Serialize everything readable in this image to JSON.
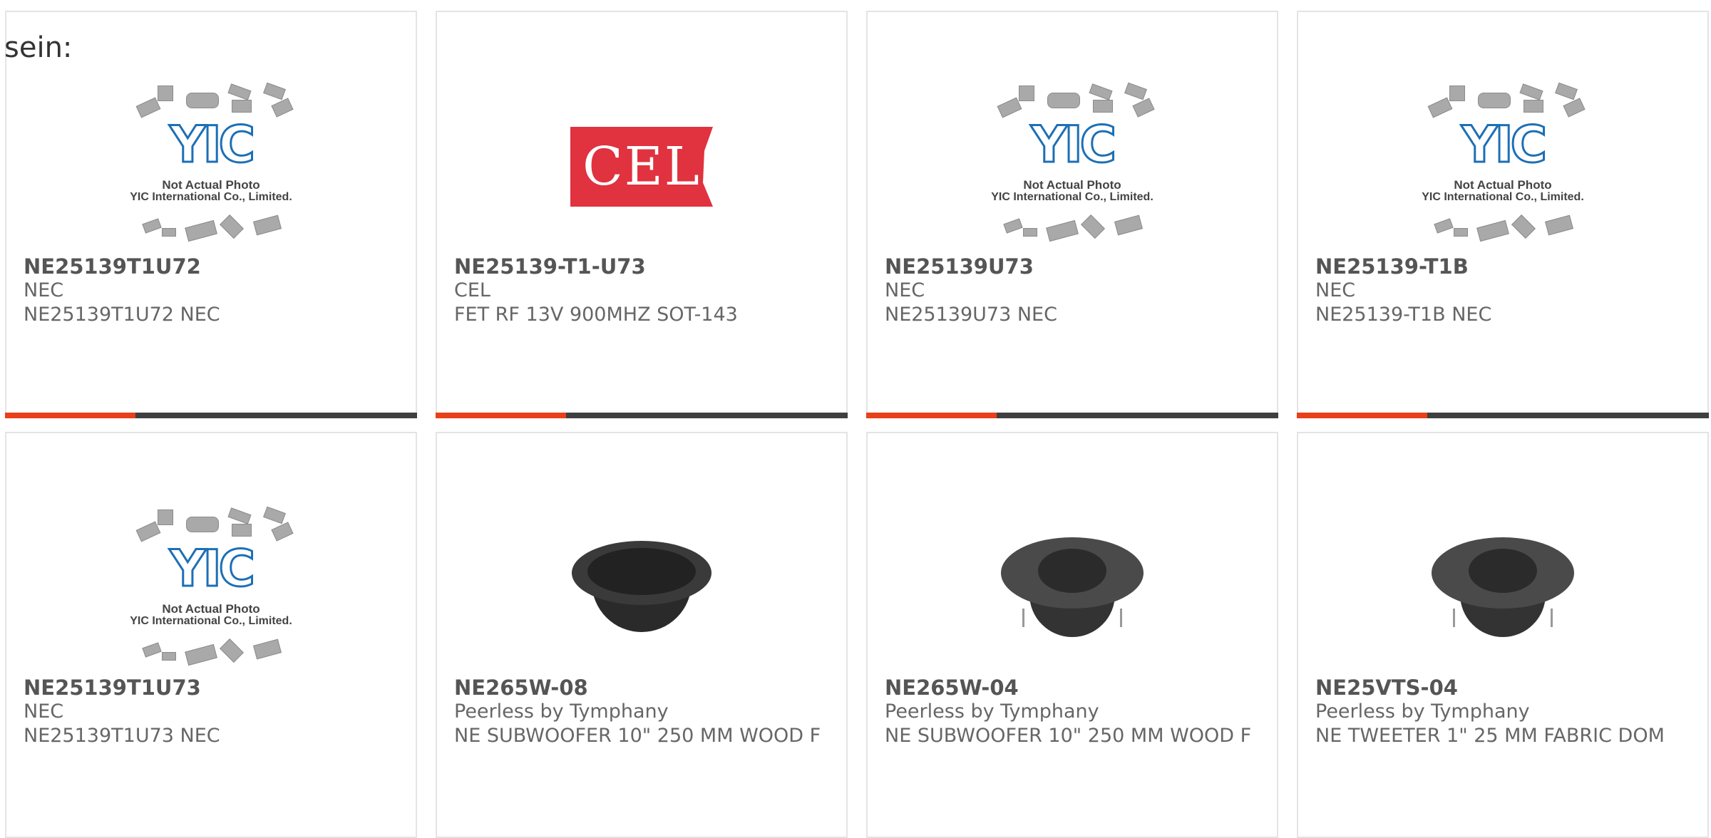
{
  "intro_text": "sein:",
  "yic_placeholder": {
    "logo": "YIC",
    "line1": "Not Actual Photo",
    "line2": "YIC International Co., Limited."
  },
  "cel_logo": "CEL",
  "colors": {
    "accent": "#e8401a",
    "bar": "#3f3f3f",
    "border": "#e4e4e4"
  },
  "products": [
    {
      "part_number": "NE25139T1U72",
      "manufacturer": "NEC",
      "description": "NE25139T1U72 NEC",
      "image": "yic-placeholder"
    },
    {
      "part_number": "NE25139-T1-U73",
      "manufacturer": "CEL",
      "description": "FET RF 13V 900MHZ SOT-143",
      "image": "cel-logo"
    },
    {
      "part_number": "NE25139U73",
      "manufacturer": "NEC",
      "description": "NE25139U73 NEC",
      "image": "yic-placeholder"
    },
    {
      "part_number": "NE25139-T1B",
      "manufacturer": "NEC",
      "description": "NE25139-T1B NEC",
      "image": "yic-placeholder"
    },
    {
      "part_number": "NE25139T1U73",
      "manufacturer": "NEC",
      "description": "NE25139T1U73 NEC",
      "image": "yic-placeholder"
    },
    {
      "part_number": "NE265W-08",
      "manufacturer": "Peerless by Tymphany",
      "description": "NE SUBWOOFER 10\" 250 MM WOOD F",
      "image": "woofer-photo"
    },
    {
      "part_number": "NE265W-04",
      "manufacturer": "Peerless by Tymphany",
      "description": "NE SUBWOOFER 10\" 250 MM WOOD F",
      "image": "tweeter-photo"
    },
    {
      "part_number": "NE25VTS-04",
      "manufacturer": "Peerless by Tymphany",
      "description": "NE TWEETER 1\" 25 MM FABRIC DOM",
      "image": "tweeter-photo"
    }
  ]
}
